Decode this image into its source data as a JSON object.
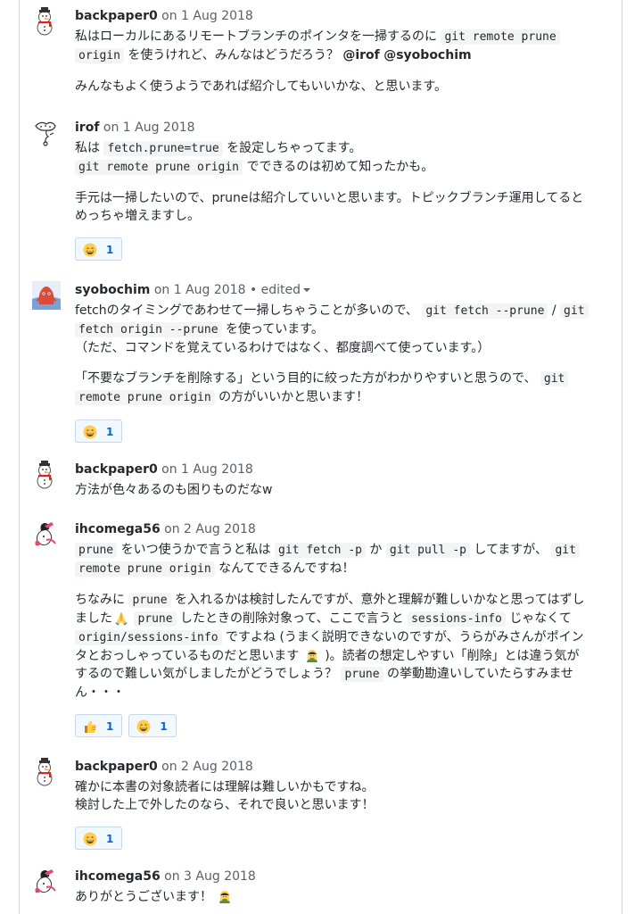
{
  "comments": [
    {
      "author": "backpaper0",
      "date": "on 1 Aug 2018",
      "paragraphs": [
        {
          "l1": "私はローカルにあるリモートブランチのポインタを一掃するのに",
          "c1": "git remote prune",
          "l2_code": "origin",
          "l2_text": "を使うけれど、みんなはどうだろう？",
          "mention1": "@irof",
          "mention2": "@syobochim"
        },
        {
          "text": "みんなもよく使うようであれば紹介してもいいかな、と思います。"
        }
      ]
    },
    {
      "author": "irof",
      "date": "on 1 Aug 2018",
      "p1": {
        "t1": "私は",
        "c1": "fetch.prune=true",
        "t2": "を設定しちゃってます。",
        "c2": "git remote prune origin",
        "t3": "でできるのは初めて知ったかも。"
      },
      "p2": {
        "line1": "手元は一掃したいので、pruneは紹介していいと思います。トピックブランチ運用してると",
        "line2": "めっちゃ増えますし。"
      },
      "reactions": [
        {
          "emoji": "laugh-emoji",
          "count": "1"
        }
      ]
    },
    {
      "author": "syobochim",
      "date": "on 1 Aug 2018",
      "edited": "• edited",
      "p1": {
        "t1": "fetchのタイミングであわせて一掃しちゃうことが多いので、",
        "c1": "git fetch --prune",
        "sep": "/",
        "c2a": "git",
        "c2b": "fetch origin --prune",
        "t2": "を使っています。",
        "t3": "（ただ、コマンドを覚えているわけではなく、都度調べて使っています。）"
      },
      "p2": {
        "t1": "「不要なブランチを削除する」という目的に絞った方がわかりやすいと思うので、",
        "c1a": "git",
        "c1b": "remote prune origin",
        "t2": "の方がいいかと思います！"
      },
      "reactions": [
        {
          "emoji": "laugh-emoji",
          "count": "1"
        }
      ]
    },
    {
      "author": "backpaper0",
      "date": "on 1 Aug 2018",
      "text": "方法が色々あるのも困りものだなw"
    },
    {
      "author": "ihcomega56",
      "date": "on 2 Aug 2018",
      "p1": {
        "c1": "prune",
        "t1": "をいつ使うかで言うと私は",
        "c2": "git fetch -p",
        "t2": "か",
        "c3": "git pull -p",
        "t3": "してますが、",
        "c4a": "git",
        "c4b": "remote prune origin",
        "t4": "なんてできるんですね！"
      },
      "p2": {
        "t1": "ちなみに",
        "c1": "prune",
        "t2": "を入れるかは検討したんですが、意外と理解が難しいかなと思ってはずし",
        "t3": "ました",
        "c2": "prune",
        "t4": "したときの削除対象って、ここで言うと",
        "c3": "sessions-info",
        "t5": "じゃなくて",
        "c4": "origin/sessions-info",
        "t6": "ですよね (うまく説明できないのですが、うらがみさんがポイン",
        "t7": "タとおっしゃっているものだと思います",
        "t8": ")。読者の想定しやすい「削除」とは違う気が",
        "t9": "するので難しい気がしましたがどうでしょう？",
        "c5": "prune",
        "t10": "の挙動勘違いしていたらすみませ",
        "t11": "ん・・・"
      },
      "reactions": [
        {
          "emoji": "thumbs-up-emoji",
          "count": "1"
        },
        {
          "emoji": "laugh-emoji",
          "count": "1"
        }
      ]
    },
    {
      "author": "backpaper0",
      "date": "on 2 Aug 2018",
      "line1": "確かに本書の対象読者には理解は難しいかもですね。",
      "line2": "検討した上で外したのなら、それで良いと思います！",
      "reactions": [
        {
          "emoji": "laugh-emoji",
          "count": "1"
        }
      ]
    },
    {
      "author": "ihcomega56",
      "date": "on 3 Aug 2018",
      "text": "ありがとうございます！"
    }
  ]
}
